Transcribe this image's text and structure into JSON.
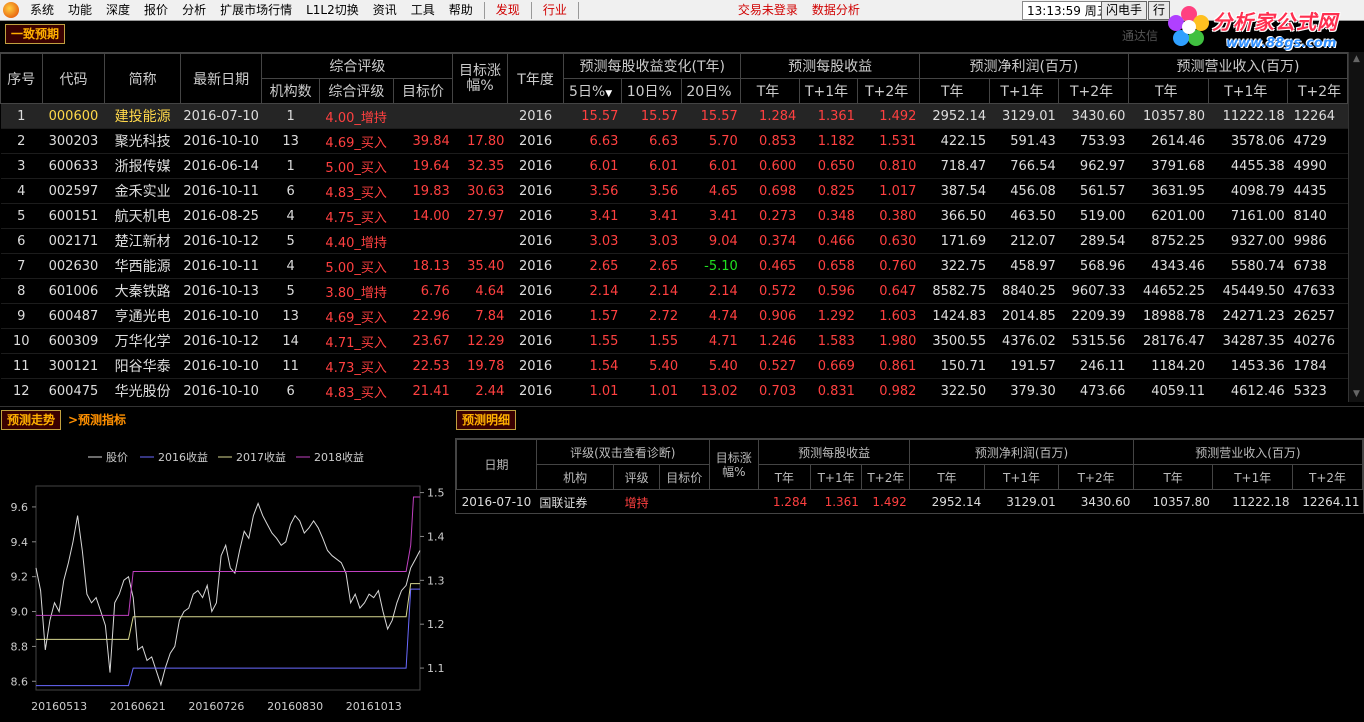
{
  "menu": {
    "items": [
      "系统",
      "功能",
      "深度",
      "报价",
      "分析",
      "扩展市场行情",
      "L1L2切换",
      "资讯",
      "工具",
      "帮助"
    ],
    "discover": "发现",
    "industry": "行业",
    "login": "交易未登录",
    "data_analysis": "数据分析",
    "clock": "13:13:59 周五",
    "flash": "闪电手",
    "flash2": "行"
  },
  "brand": {
    "title": "分析家公式网",
    "url": "www.88gs.com"
  },
  "panel": {
    "title": "一致预期",
    "faded_text": "通达信"
  },
  "grid": {
    "group_headers": {
      "rating": "综合评级",
      "target_gain": "目标涨幅%",
      "t_year": "T年度",
      "eps_change": "预测每股收益变化(T年)",
      "eps": "预测每股收益",
      "net_profit": "预测净利润(百万)",
      "revenue": "预测营业收入(百万)"
    },
    "headers": {
      "seq": "序号",
      "code": "代码",
      "name": "简称",
      "date": "最新日期",
      "inst": "机构数",
      "rating": "综合评级",
      "target": "目标价",
      "d5": "5日%",
      "d10": "10日%",
      "d20": "20日%",
      "t": "T年",
      "t1": "T+1年",
      "t2": "T+2年"
    },
    "rows": [
      [
        "1",
        "000600",
        "建投能源",
        "2016-07-10",
        "1",
        "4.00_增持",
        "",
        "",
        "2016",
        "15.57",
        "15.57",
        "15.57",
        "1.284",
        "1.361",
        "1.492",
        "2952.14",
        "3129.01",
        "3430.60",
        "10357.80",
        "11222.18",
        "12264"
      ],
      [
        "2",
        "300203",
        "聚光科技",
        "2016-10-10",
        "13",
        "4.69_买入",
        "39.84",
        "17.80",
        "2016",
        "6.63",
        "6.63",
        "5.70",
        "0.853",
        "1.182",
        "1.531",
        "422.15",
        "591.43",
        "753.93",
        "2614.46",
        "3578.06",
        "4729"
      ],
      [
        "3",
        "600633",
        "浙报传媒",
        "2016-06-14",
        "1",
        "5.00_买入",
        "19.64",
        "32.35",
        "2016",
        "6.01",
        "6.01",
        "6.01",
        "0.600",
        "0.650",
        "0.810",
        "718.47",
        "766.54",
        "962.97",
        "3791.68",
        "4455.38",
        "4990"
      ],
      [
        "4",
        "002597",
        "金禾实业",
        "2016-10-11",
        "6",
        "4.83_买入",
        "19.83",
        "30.63",
        "2016",
        "3.56",
        "3.56",
        "4.65",
        "0.698",
        "0.825",
        "1.017",
        "387.54",
        "456.08",
        "561.57",
        "3631.95",
        "4098.79",
        "4435"
      ],
      [
        "5",
        "600151",
        "航天机电",
        "2016-08-25",
        "4",
        "4.75_买入",
        "14.00",
        "27.97",
        "2016",
        "3.41",
        "3.41",
        "3.41",
        "0.273",
        "0.348",
        "0.380",
        "366.50",
        "463.50",
        "519.00",
        "6201.00",
        "7161.00",
        "8140"
      ],
      [
        "6",
        "002171",
        "楚江新材",
        "2016-10-12",
        "5",
        "4.40_增持",
        "",
        "",
        "2016",
        "3.03",
        "3.03",
        "9.04",
        "0.374",
        "0.466",
        "0.630",
        "171.69",
        "212.07",
        "289.54",
        "8752.25",
        "9327.00",
        "9986"
      ],
      [
        "7",
        "002630",
        "华西能源",
        "2016-10-11",
        "4",
        "5.00_买入",
        "18.13",
        "35.40",
        "2016",
        "2.65",
        "2.65",
        "-5.10",
        "0.465",
        "0.658",
        "0.760",
        "322.75",
        "458.97",
        "568.96",
        "4343.46",
        "5580.74",
        "6738"
      ],
      [
        "8",
        "601006",
        "大秦铁路",
        "2016-10-13",
        "5",
        "3.80_增持",
        "6.76",
        "4.64",
        "2016",
        "2.14",
        "2.14",
        "2.14",
        "0.572",
        "0.596",
        "0.647",
        "8582.75",
        "8840.25",
        "9607.33",
        "44652.25",
        "45449.50",
        "47633"
      ],
      [
        "9",
        "600487",
        "亨通光电",
        "2016-10-10",
        "13",
        "4.69_买入",
        "22.96",
        "7.84",
        "2016",
        "1.57",
        "2.72",
        "4.74",
        "0.906",
        "1.292",
        "1.603",
        "1424.83",
        "2014.85",
        "2209.39",
        "18988.78",
        "24271.23",
        "26257"
      ],
      [
        "10",
        "600309",
        "万华化学",
        "2016-10-12",
        "14",
        "4.71_买入",
        "23.67",
        "12.29",
        "2016",
        "1.55",
        "1.55",
        "4.71",
        "1.246",
        "1.583",
        "1.980",
        "3500.55",
        "4376.02",
        "5315.56",
        "28176.47",
        "34287.35",
        "40276"
      ],
      [
        "11",
        "300121",
        "阳谷华泰",
        "2016-10-10",
        "11",
        "4.73_买入",
        "22.53",
        "19.78",
        "2016",
        "1.54",
        "5.40",
        "5.40",
        "0.527",
        "0.669",
        "0.861",
        "150.71",
        "191.57",
        "246.11",
        "1184.20",
        "1453.36",
        "1784"
      ],
      [
        "12",
        "600475",
        "华光股份",
        "2016-10-10",
        "6",
        "4.83_买入",
        "21.41",
        "2.44",
        "2016",
        "1.01",
        "1.01",
        "13.02",
        "0.703",
        "0.831",
        "0.982",
        "322.50",
        "379.30",
        "473.66",
        "4059.11",
        "4612.46",
        "5323"
      ]
    ]
  },
  "bottom_tabs": {
    "trend": "预测走势",
    "indicator": ">预测指标",
    "detail": "预测明细"
  },
  "chart_data": {
    "type": "line",
    "series": [
      {
        "name": "股价",
        "color": "#d8d8d8",
        "axis": "left",
        "x": [
          0,
          5,
          10,
          15,
          20,
          25,
          30,
          35,
          40,
          45,
          50,
          55,
          60,
          65,
          70,
          75,
          80,
          85,
          90,
          95,
          100,
          105,
          110,
          115,
          120,
          125,
          130,
          135,
          140,
          145,
          150,
          155,
          160,
          165,
          170,
          175,
          180,
          185,
          190,
          195,
          200,
          205,
          210,
          215,
          220,
          225,
          230,
          235,
          240,
          245,
          250,
          255,
          260,
          265,
          270,
          275,
          280,
          285,
          290,
          295,
          300,
          305,
          310,
          315,
          320,
          325,
          330,
          335,
          340,
          345,
          350,
          355,
          360,
          365,
          370,
          375,
          380,
          385,
          390,
          395,
          400,
          405,
          410,
          415
        ],
        "values": [
          9.25,
          9.12,
          8.78,
          8.95,
          9.05,
          9.0,
          9.18,
          9.28,
          9.4,
          9.55,
          9.35,
          9.1,
          9.05,
          9.08,
          9.0,
          8.92,
          8.65,
          9.05,
          9.1,
          9.18,
          9.2,
          9.08,
          8.78,
          8.8,
          8.72,
          8.74,
          8.66,
          8.58,
          8.68,
          8.76,
          8.8,
          8.95,
          9.0,
          9.02,
          9.1,
          9.12,
          9.08,
          9.15,
          9.0,
          9.05,
          9.32,
          9.38,
          9.25,
          9.22,
          9.35,
          9.46,
          9.42,
          9.55,
          9.62,
          9.55,
          9.5,
          9.45,
          9.42,
          9.38,
          9.4,
          9.5,
          9.55,
          9.52,
          9.45,
          9.48,
          9.52,
          9.48,
          9.42,
          9.35,
          9.32,
          9.3,
          9.28,
          9.22,
          9.05,
          9.1,
          9.02,
          9.05,
          9.1,
          9.08,
          9.12,
          9.0,
          8.9,
          8.95,
          9.05,
          9.12,
          9.15,
          9.25,
          9.3,
          9.35
        ]
      },
      {
        "name": "2016收益",
        "color": "#6a6aff",
        "axis": "right",
        "x": [
          0,
          100,
          105,
          200,
          300,
          400,
          405,
          415
        ],
        "values": [
          1.06,
          1.06,
          1.1,
          1.1,
          1.1,
          1.1,
          1.28,
          1.28
        ]
      },
      {
        "name": "2017收益",
        "color": "#d8d890",
        "axis": "left",
        "x": [
          0,
          100,
          105,
          200,
          300,
          400,
          405,
          415
        ],
        "values": [
          8.84,
          8.84,
          8.97,
          8.97,
          8.97,
          8.97,
          9.16,
          9.16
        ]
      },
      {
        "name": "2018收益",
        "color": "#c040c0",
        "axis": "right",
        "x": [
          0,
          100,
          105,
          200,
          300,
          400,
          405,
          408,
          412,
          415
        ],
        "values": [
          1.22,
          1.22,
          1.32,
          1.32,
          1.32,
          1.32,
          1.38,
          1.49,
          1.49,
          1.49
        ]
      }
    ],
    "x_ticks": [
      {
        "x": 25,
        "label": "20160513"
      },
      {
        "x": 110,
        "label": "20160621"
      },
      {
        "x": 195,
        "label": "20160726"
      },
      {
        "x": 280,
        "label": "20160830"
      },
      {
        "x": 365,
        "label": "20161013"
      }
    ],
    "left_ticks": [
      9.6,
      9.4,
      9.2,
      9.0,
      8.8,
      8.6
    ],
    "right_ticks": [
      1.5,
      1.4,
      1.3,
      1.2,
      1.1
    ],
    "ylim_left": [
      8.55,
      9.72
    ],
    "ylim_right": [
      1.05,
      1.515
    ],
    "xlim": [
      0,
      415
    ]
  },
  "detail": {
    "group_headers": {
      "date": "日期",
      "rating": "评级(双击查看诊断)",
      "target_gain": "目标涨幅%",
      "eps": "预测每股收益",
      "net_profit": "预测净利润(百万)",
      "revenue": "预测营业收入(百万)"
    },
    "headers": {
      "inst": "机构",
      "rating": "评级",
      "target": "目标价",
      "t": "T年",
      "t1": "T+1年",
      "t2": "T+2年"
    },
    "row": [
      "2016-07-10",
      "国联证券",
      "增持",
      "",
      "",
      "1.284",
      "1.361",
      "1.492",
      "2952.14",
      "3129.01",
      "3430.60",
      "10357.80",
      "11222.18",
      "12264.11"
    ]
  }
}
